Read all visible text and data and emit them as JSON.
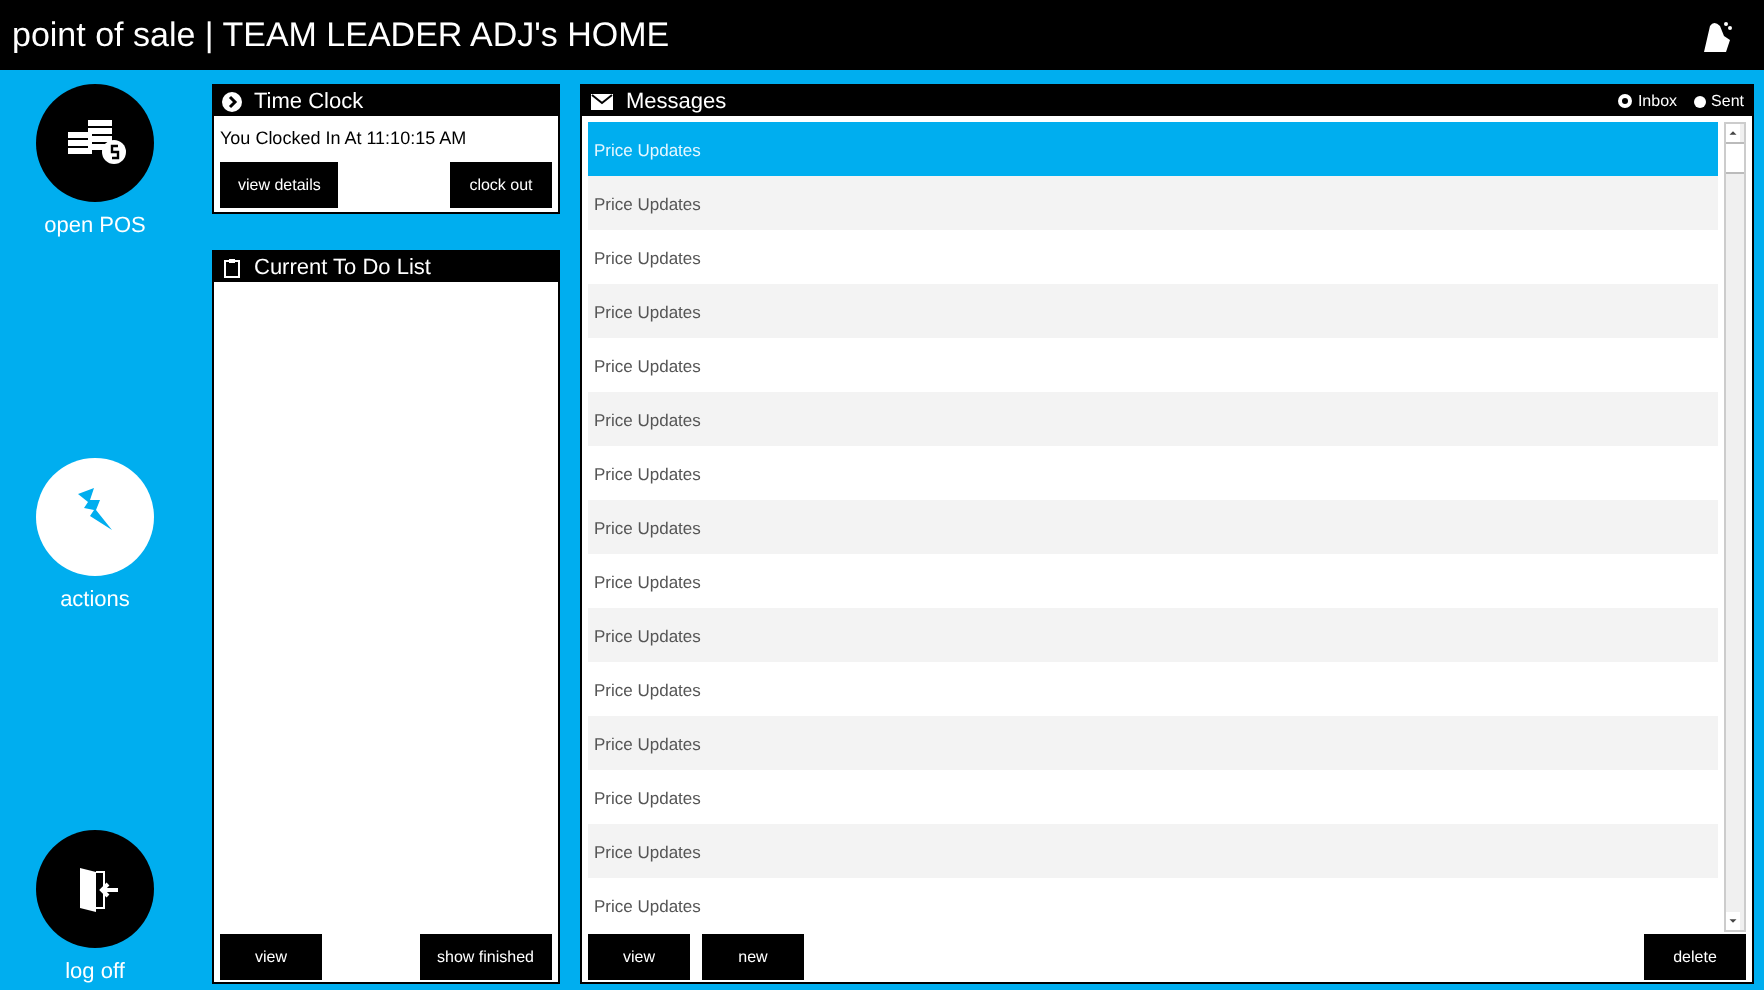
{
  "header": {
    "title": "point of sale | TEAM LEADER ADJ's HOME"
  },
  "sidebar": {
    "items": [
      {
        "kind": "pos",
        "label": "open POS"
      },
      {
        "kind": "actions",
        "label": "actions"
      },
      {
        "kind": "logoff",
        "label": "log off"
      }
    ]
  },
  "time_clock": {
    "title": "Time Clock",
    "status": "You Clocked In At 11:10:15 AM",
    "buttons": [
      "view details",
      "clock out"
    ]
  },
  "todo": {
    "title": "Current To Do List",
    "buttons": [
      "view",
      "show finished"
    ]
  },
  "messages": {
    "title": "Messages",
    "filters": [
      {
        "label": "Inbox",
        "selected": true
      },
      {
        "label": "Sent",
        "selected": false
      }
    ],
    "rows": [
      {
        "subject": "Price Updates",
        "selected": true
      },
      {
        "subject": "Price Updates",
        "selected": false
      },
      {
        "subject": "Price Updates",
        "selected": false
      },
      {
        "subject": "Price Updates",
        "selected": false
      },
      {
        "subject": "Price Updates",
        "selected": false
      },
      {
        "subject": "Price Updates",
        "selected": false
      },
      {
        "subject": "Price Updates",
        "selected": false
      },
      {
        "subject": "Price Updates",
        "selected": false
      },
      {
        "subject": "Price Updates",
        "selected": false
      },
      {
        "subject": "Price Updates",
        "selected": false
      },
      {
        "subject": "Price Updates",
        "selected": false
      },
      {
        "subject": "Price Updates",
        "selected": false
      },
      {
        "subject": "Price Updates",
        "selected": false
      },
      {
        "subject": "Price Updates",
        "selected": false
      },
      {
        "subject": "Price Updates",
        "selected": false
      }
    ],
    "buttons": [
      "view",
      "new",
      "delete"
    ]
  }
}
